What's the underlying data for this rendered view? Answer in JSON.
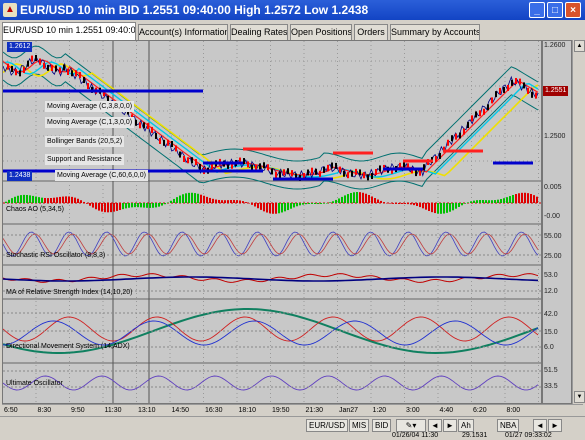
{
  "window": {
    "title": "EUR/USD 10 min BID 1.2551 09:40:00 High 1.2572 Low 1.2438",
    "icon": "chart-app-icon",
    "buttons": [
      "minimize",
      "maximize",
      "close"
    ]
  },
  "tabs": [
    {
      "label": "EUR/USD 10 min 1.2551 09:40:00",
      "active": true
    },
    {
      "label": "Account(s) Information",
      "active": false
    },
    {
      "label": "Dealing Rates",
      "active": false
    },
    {
      "label": "Open Positions",
      "active": false
    },
    {
      "label": "Orders",
      "active": false
    },
    {
      "label": "Summary by Accounts",
      "active": false
    }
  ],
  "price_panel": {
    "high_box": "1.2612",
    "low_box": "1.2438",
    "current_price": "1.2551",
    "indicators": [
      "Moving Average (C,3,8,0,0)",
      "Moving Average (C,1,3,0,0)",
      "Bollinger Bands (20,5,2)",
      "Support and Resistance",
      "Moving Average (C,60,6,0,0)"
    ],
    "scale_ticks": [
      "1.2600",
      "1.2500"
    ]
  },
  "indicator_panels": [
    {
      "label": "Chaos AO (5,34,5)",
      "ticks": [
        "0.005",
        "-0.00"
      ]
    },
    {
      "label": "Stochastic RSI Oscillator (8,8,3)",
      "ticks": [
        "55.00",
        "25.00"
      ]
    },
    {
      "label": "MA of Relative Strength Index (14,10,20)",
      "ticks": [
        "53.0",
        "12.0"
      ]
    },
    {
      "label": "Directional Movement System (14,ADX)",
      "ticks": [
        "42.0",
        "15.0",
        "6.0"
      ]
    },
    {
      "label": "Ultimate Oscillator",
      "ticks": [
        "51.5",
        "33.5"
      ]
    }
  ],
  "time_axis": [
    "6:50",
    "8:30",
    "9:50",
    "11:30",
    "13:10",
    "14:50",
    "16:30",
    "18:10",
    "19:50",
    "21:30",
    "Jan27",
    "1:20",
    "3:00",
    "4:40",
    "6:20",
    "8:00"
  ],
  "bottom_toolbar": {
    "symbol": "EUR/USD",
    "interval": "MIS",
    "side": "BID",
    "mode_a": "Ah",
    "mode_b": "NBA"
  },
  "status": {
    "left": "01/26/04 11:30",
    "mid": "29.1531",
    "right": "01/27 09:33:02"
  },
  "colors": {
    "background": "#c8c8c8",
    "up_candle": "#ff0000",
    "support": "#0000cc",
    "ma_yellow": "#f0e000",
    "ma_cyan": "#00c8e8",
    "ma_red": "#ff2020",
    "ao_green": "#00c000",
    "ao_red": "#e00000"
  }
}
